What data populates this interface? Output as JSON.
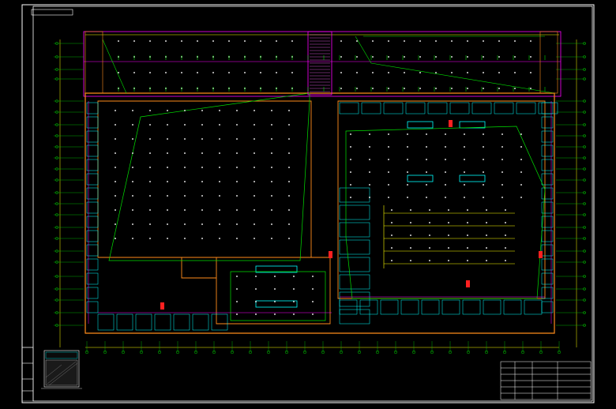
{
  "drawing": {
    "top_left_stamp": "",
    "plan_caption": "",
    "legend_caption": "",
    "stair_label": ""
  },
  "title_block": {
    "cells": [
      "",
      "",
      "",
      "",
      "",
      "",
      "",
      "",
      "",
      ""
    ]
  },
  "colors": {
    "background": "#000000",
    "frame": "#ffffff",
    "wall": "#ff8c1a",
    "axis": "#ffff00",
    "room": "#00ffff",
    "area_outline": "#00e000",
    "duct": "#ff00ff",
    "column": "#ffffff",
    "dim_red": "#ff2020"
  }
}
